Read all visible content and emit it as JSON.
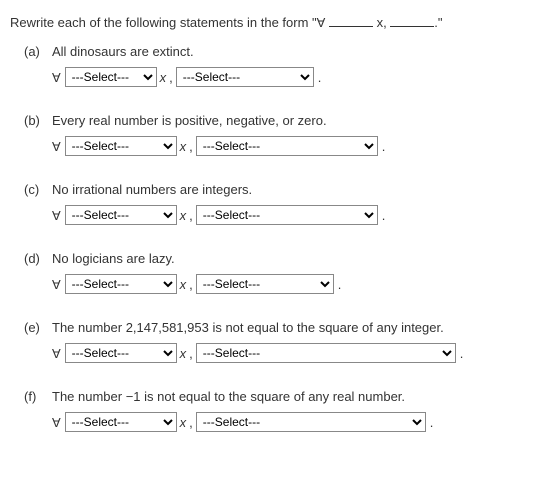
{
  "instruction_pre": "Rewrite each of the following statements in the form \"",
  "instruction_mid": " x, ",
  "instruction_end": ".\"",
  "forall": "A",
  "xvar": "x",
  "comma": ",",
  "period": ".",
  "select_placeholder": "---Select---",
  "problems": {
    "a": {
      "label": "(a)",
      "statement": "All dinosaurs are extinct."
    },
    "b": {
      "label": "(b)",
      "statement": "Every real number is positive, negative, or zero."
    },
    "c": {
      "label": "(c)",
      "statement": "No irrational numbers are integers."
    },
    "d": {
      "label": "(d)",
      "statement": "No logicians are lazy."
    },
    "e": {
      "label": "(e)",
      "statement": "The number 2,147,581,953 is not equal to the square of any integer."
    },
    "f": {
      "label": "(f)",
      "statement": "The number −1 is not equal to the square of any real number."
    }
  }
}
